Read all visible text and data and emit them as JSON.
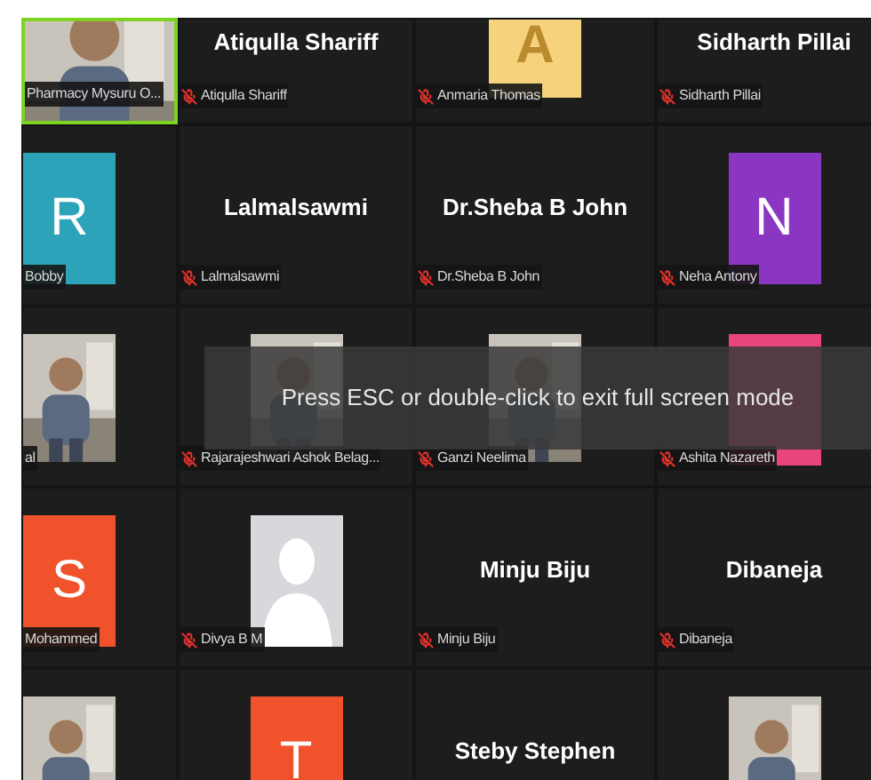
{
  "rows": [
    {
      "tiles": [
        {
          "kind": "picture",
          "label": "Pharmacy Mysuru O...",
          "speaking": true
        },
        {
          "kind": "name",
          "name": "Atiqulla Shariff",
          "label": "Atiqulla Shariff",
          "speaking": false
        },
        {
          "kind": "avatar",
          "letter": "A",
          "color": "#f6d27c",
          "label": "Anmaria Thomas",
          "speaking": false
        },
        {
          "kind": "name",
          "name": "Sidharth Pillai",
          "label": "Sidharth Pillai",
          "speaking": false
        }
      ]
    },
    {
      "tiles": [
        {
          "kind": "avatar",
          "letter": "R",
          "color": "#2ca3b8",
          "label": "Bobby",
          "speaking": false
        },
        {
          "kind": "name",
          "name": "Lalmalsawmi",
          "label": "Lalmalsawmi",
          "speaking": false
        },
        {
          "kind": "name",
          "name": "Dr.Sheba B John",
          "label": "Dr.Sheba B John",
          "speaking": false
        },
        {
          "kind": "avatar",
          "letter": "N",
          "color": "#8b36c2",
          "label": "Neha Antony",
          "speaking": false
        }
      ]
    },
    {
      "tiles": [
        {
          "kind": "picture",
          "label": "al",
          "speaking": false
        },
        {
          "kind": "picture",
          "label": "Rajarajeshwari Ashok Belag...",
          "speaking": false
        },
        {
          "kind": "picture",
          "label": "Ganzi Neelima",
          "speaking": false
        },
        {
          "kind": "avatar",
          "color": "#e8457d",
          "label": "Ashita Nazareth",
          "speaking": false
        }
      ]
    },
    {
      "tiles": [
        {
          "kind": "avatar",
          "letter": "S",
          "color": "#f0532c",
          "label": "Mohammed",
          "speaking": false
        },
        {
          "kind": "silhouette",
          "label": "Divya B M",
          "speaking": false
        },
        {
          "kind": "name",
          "name": "Minju Biju",
          "label": "Minju Biju",
          "speaking": false
        },
        {
          "kind": "name",
          "name": "Dibaneja",
          "label": "Dibaneja",
          "speaking": false
        }
      ]
    },
    {
      "tiles": [
        {
          "kind": "picture",
          "speaking": false
        },
        {
          "kind": "avatar",
          "letter": "T",
          "color": "#f0532c",
          "speaking": false
        },
        {
          "kind": "name",
          "name": "Steby Stephen",
          "speaking": false
        },
        {
          "kind": "picture",
          "speaking": false
        }
      ]
    }
  ],
  "notice": "Press ESC or double-click to exit full screen mode"
}
